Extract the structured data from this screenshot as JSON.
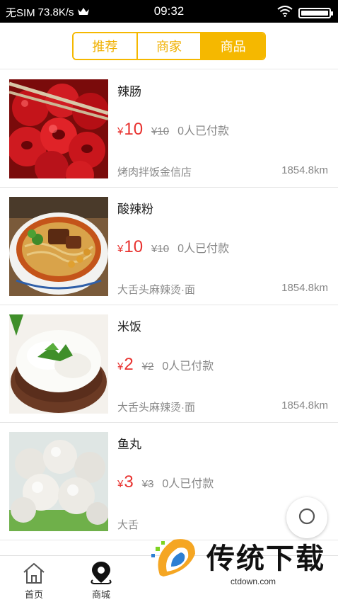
{
  "status_bar": {
    "carrier": "无SIM",
    "speed": "73.8K/s",
    "time": "09:32"
  },
  "tabs": [
    {
      "label": "推荐",
      "active": false
    },
    {
      "label": "商家",
      "active": false
    },
    {
      "label": "商品",
      "active": true
    }
  ],
  "products": [
    {
      "name": "辣肠",
      "currency": "¥",
      "price": "10",
      "original_price": "¥10",
      "sold": "0人已付款",
      "shop": "烤肉拌饭金信店",
      "distance": "1854.8km"
    },
    {
      "name": "酸辣粉",
      "currency": "¥",
      "price": "10",
      "original_price": "¥10",
      "sold": "0人已付款",
      "shop": "大舌头麻辣烫·面",
      "distance": "1854.8km"
    },
    {
      "name": "米饭",
      "currency": "¥",
      "price": "2",
      "original_price": "¥2",
      "sold": "0人已付款",
      "shop": "大舌头麻辣烫·面",
      "distance": "1854.8km"
    },
    {
      "name": "鱼丸",
      "currency": "¥",
      "price": "3",
      "original_price": "¥3",
      "sold": "0人已付款",
      "shop": "大舌",
      "distance": ""
    }
  ],
  "bottom_nav": [
    {
      "label": "首页",
      "icon": "home-icon"
    },
    {
      "label": "商城",
      "icon": "location-pin-icon"
    }
  ],
  "watermark": {
    "text": "传统下载",
    "url": "ctdown.com"
  },
  "colors": {
    "accent": "#f5b800",
    "price": "#e8322f",
    "muted": "#888888"
  }
}
